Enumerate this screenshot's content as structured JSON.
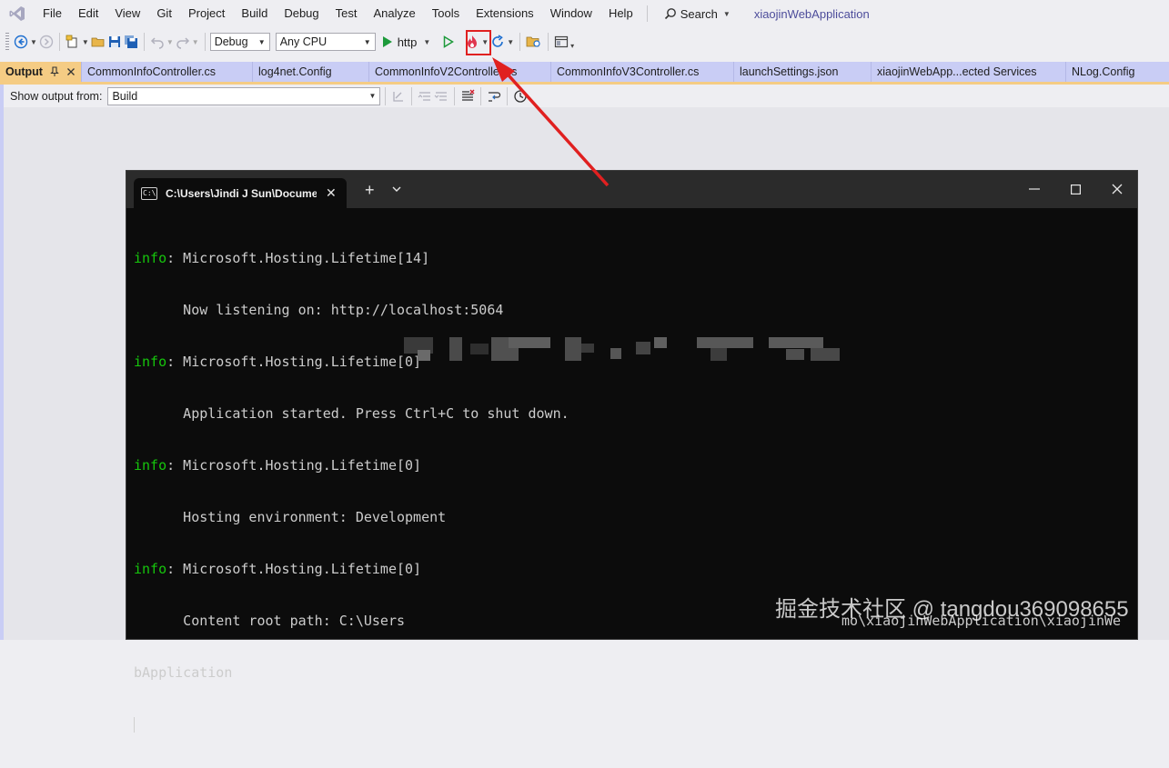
{
  "menu": {
    "items": [
      "File",
      "Edit",
      "View",
      "Git",
      "Project",
      "Build",
      "Debug",
      "Test",
      "Analyze",
      "Tools",
      "Extensions",
      "Window",
      "Help"
    ],
    "search_label": "Search",
    "app_name": "xiaojinWebApplication"
  },
  "toolbar": {
    "configuration": "Debug",
    "platform": "Any CPU",
    "run_profile": "http"
  },
  "tabs": {
    "output_label": "Output",
    "documents": [
      "CommonInfoController.cs",
      "log4net.Config",
      "CommonInfoV2Controller.cs",
      "CommonInfoV3Controller.cs",
      "launchSettings.json",
      "xiaojinWebApp...ected Services",
      "NLog.Config"
    ]
  },
  "output": {
    "show_from_label": "Show output from:",
    "source": "Build"
  },
  "terminal": {
    "tab_title": "C:\\Users\\Jindi J Sun\\Documer",
    "lines": [
      {
        "prefix": "info",
        "text": ": Microsoft.Hosting.Lifetime[14]"
      },
      {
        "prefix": "",
        "text": "      Now listening on: http://localhost:5064"
      },
      {
        "prefix": "info",
        "text": ": Microsoft.Hosting.Lifetime[0]"
      },
      {
        "prefix": "",
        "text": "      Application started. Press Ctrl+C to shut down."
      },
      {
        "prefix": "info",
        "text": ": Microsoft.Hosting.Lifetime[0]"
      },
      {
        "prefix": "",
        "text": "      Hosting environment: Development"
      },
      {
        "prefix": "info",
        "text": ": Microsoft.Hosting.Lifetime[0]"
      },
      {
        "prefix": "",
        "text": "      Content root path: C:\\Users"
      },
      {
        "prefix": "",
        "text": "bApplication"
      }
    ],
    "content_root_tail": "mo\\xiaojinWebApplication\\xiaojinWe"
  },
  "watermark": "掘金技术社区 @ tangdou369098655",
  "colors": {
    "tab_active": "#f5cc84",
    "tabstrip": "#c9cdf5",
    "terminal_bg": "#0c0c0c",
    "info_green": "#16c60c",
    "annotation_red": "#e02020"
  }
}
